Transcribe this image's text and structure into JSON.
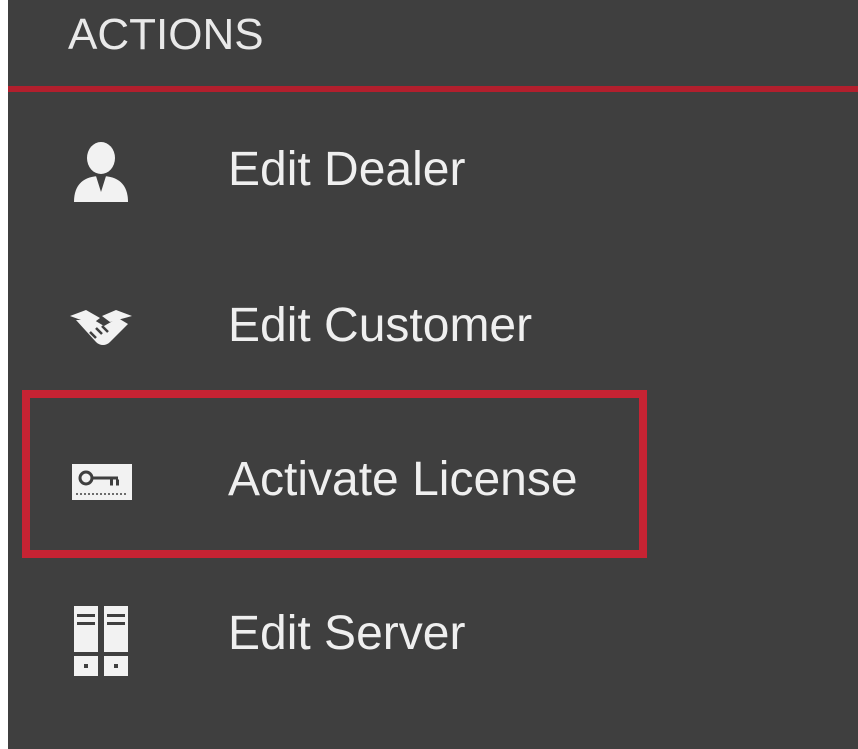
{
  "panel": {
    "title": "ACTIONS",
    "accent_color": "#b21f2d",
    "highlight_color": "#c62333",
    "background_color": "#3f3f3f"
  },
  "menu": {
    "items": [
      {
        "label": "Edit Dealer",
        "icon": "user-icon"
      },
      {
        "label": "Edit Customer",
        "icon": "handshake-icon"
      },
      {
        "label": "Activate License",
        "icon": "license-key-icon"
      },
      {
        "label": "Edit Server",
        "icon": "server-icon"
      }
    ]
  }
}
